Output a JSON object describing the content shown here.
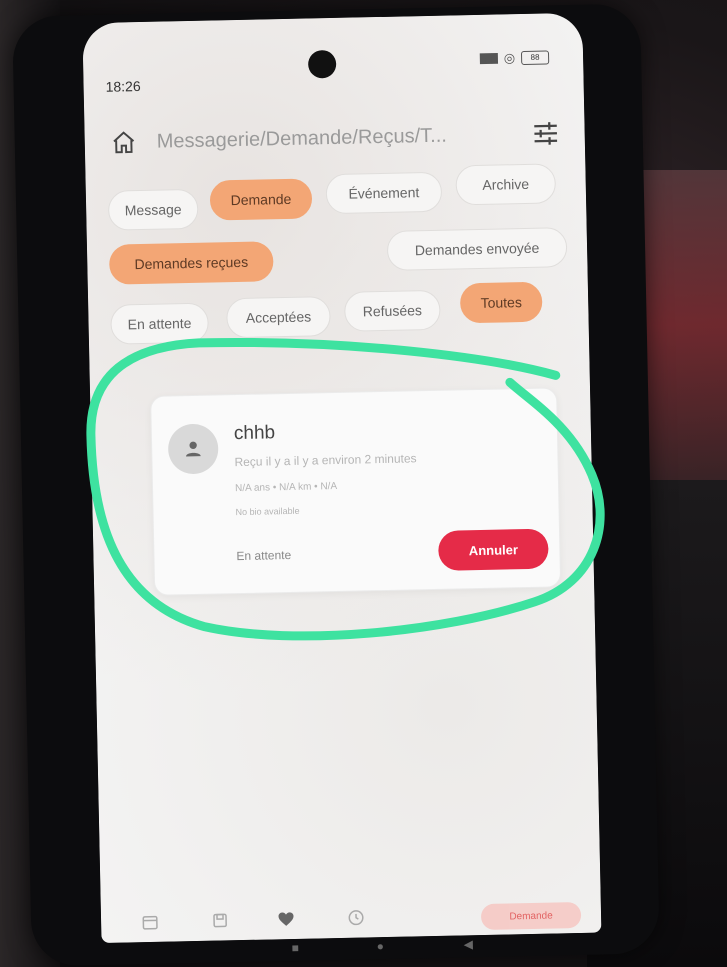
{
  "status_bar": {
    "time": "18:26",
    "signal": "▉▉▉",
    "wifi": "◎",
    "battery": "88"
  },
  "header": {
    "breadcrumb": "Messagerie/Demande/Reçus/T..."
  },
  "category_tabs": [
    {
      "label": "Message",
      "active": false
    },
    {
      "label": "Demande",
      "active": true
    },
    {
      "label": "Événement",
      "active": false
    },
    {
      "label": "Archive",
      "active": false
    }
  ],
  "direction_tabs": [
    {
      "label": "Demandes reçues",
      "active": true
    },
    {
      "label": "Demandes envoyée",
      "active": false
    }
  ],
  "status_filters": [
    {
      "label": "En attente",
      "active": false
    },
    {
      "label": "Acceptées",
      "active": false
    },
    {
      "label": "Refusées",
      "active": false
    },
    {
      "label": "Toutes",
      "active": true
    }
  ],
  "request_card": {
    "name": "chhb",
    "received": "Reçu il y a il y a environ 2 minutes",
    "details": "N/A ans • N/A km • N/A",
    "bio": "No bio available",
    "status": "En attente",
    "cancel_label": "Annuler"
  },
  "bottom_nav": {
    "active_label": "Demande"
  },
  "colors": {
    "accent_orange": "#f3a675",
    "cancel_red": "#e52b48",
    "highlight_green": "#3ee2a0"
  }
}
